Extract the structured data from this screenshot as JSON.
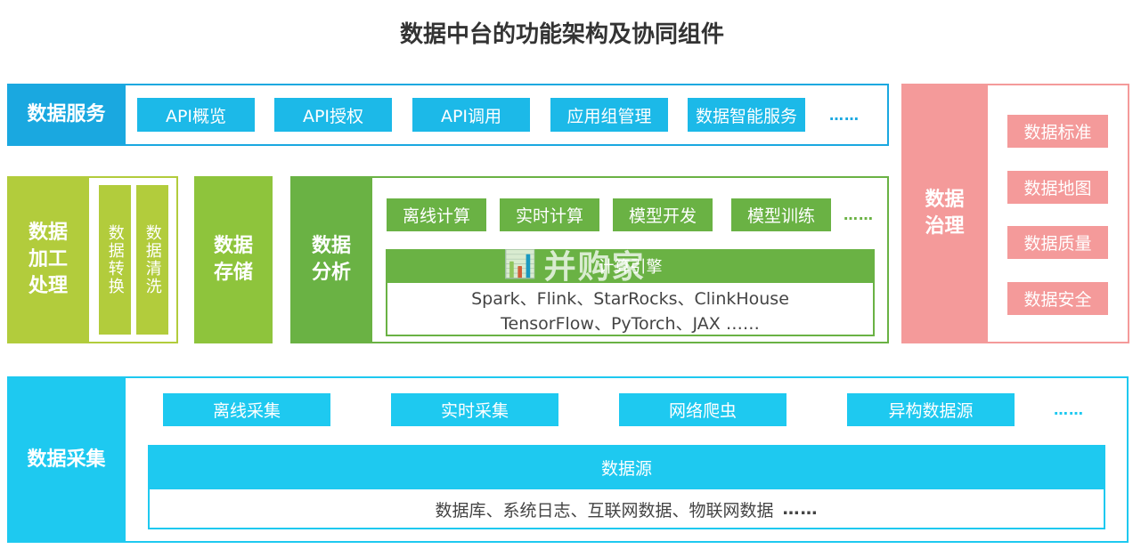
{
  "title": "数据中台的功能架构及协同组件",
  "colors": {
    "service_blue": "#1aa8e0",
    "chip_blue": "#1cb9e8",
    "collect_blue": "#1ec9f0",
    "process_green": "#b2cc3c",
    "storage_green": "#8ec43c",
    "analysis_green": "#6ab244",
    "governance_pink": "#f49a9a"
  },
  "service": {
    "label": "数据服务",
    "items": [
      "API概览",
      "API授权",
      "API调用",
      "应用组管理",
      "数据智能服务"
    ],
    "more": "……"
  },
  "processing": {
    "label": "数据加工处理",
    "sub": [
      "数据转换",
      "数据清洗"
    ]
  },
  "storage": {
    "label": "数据存储"
  },
  "analysis": {
    "label": "数据分析",
    "items": [
      "离线计算",
      "实时计算",
      "模型开发",
      "模型训练"
    ],
    "more": "……",
    "engine_title": "计算引擎",
    "engine_line1": "Spark、Flink、StarRocks、ClinkHouse",
    "engine_line2": "TensorFlow、PyTorch、JAX ……"
  },
  "governance": {
    "label": "数据治理",
    "items": [
      "数据标准",
      "数据地图",
      "数据质量",
      "数据安全"
    ]
  },
  "collection": {
    "label": "数据采集",
    "items": [
      "离线采集",
      "实时采集",
      "网络爬虫",
      "异构数据源"
    ],
    "more": "……",
    "source_title": "数据源",
    "source_text": "数据库、系统日志、互联网数据、物联网数据",
    "source_more": "……"
  },
  "watermark": {
    "icon": "📊",
    "text": "并购家"
  }
}
